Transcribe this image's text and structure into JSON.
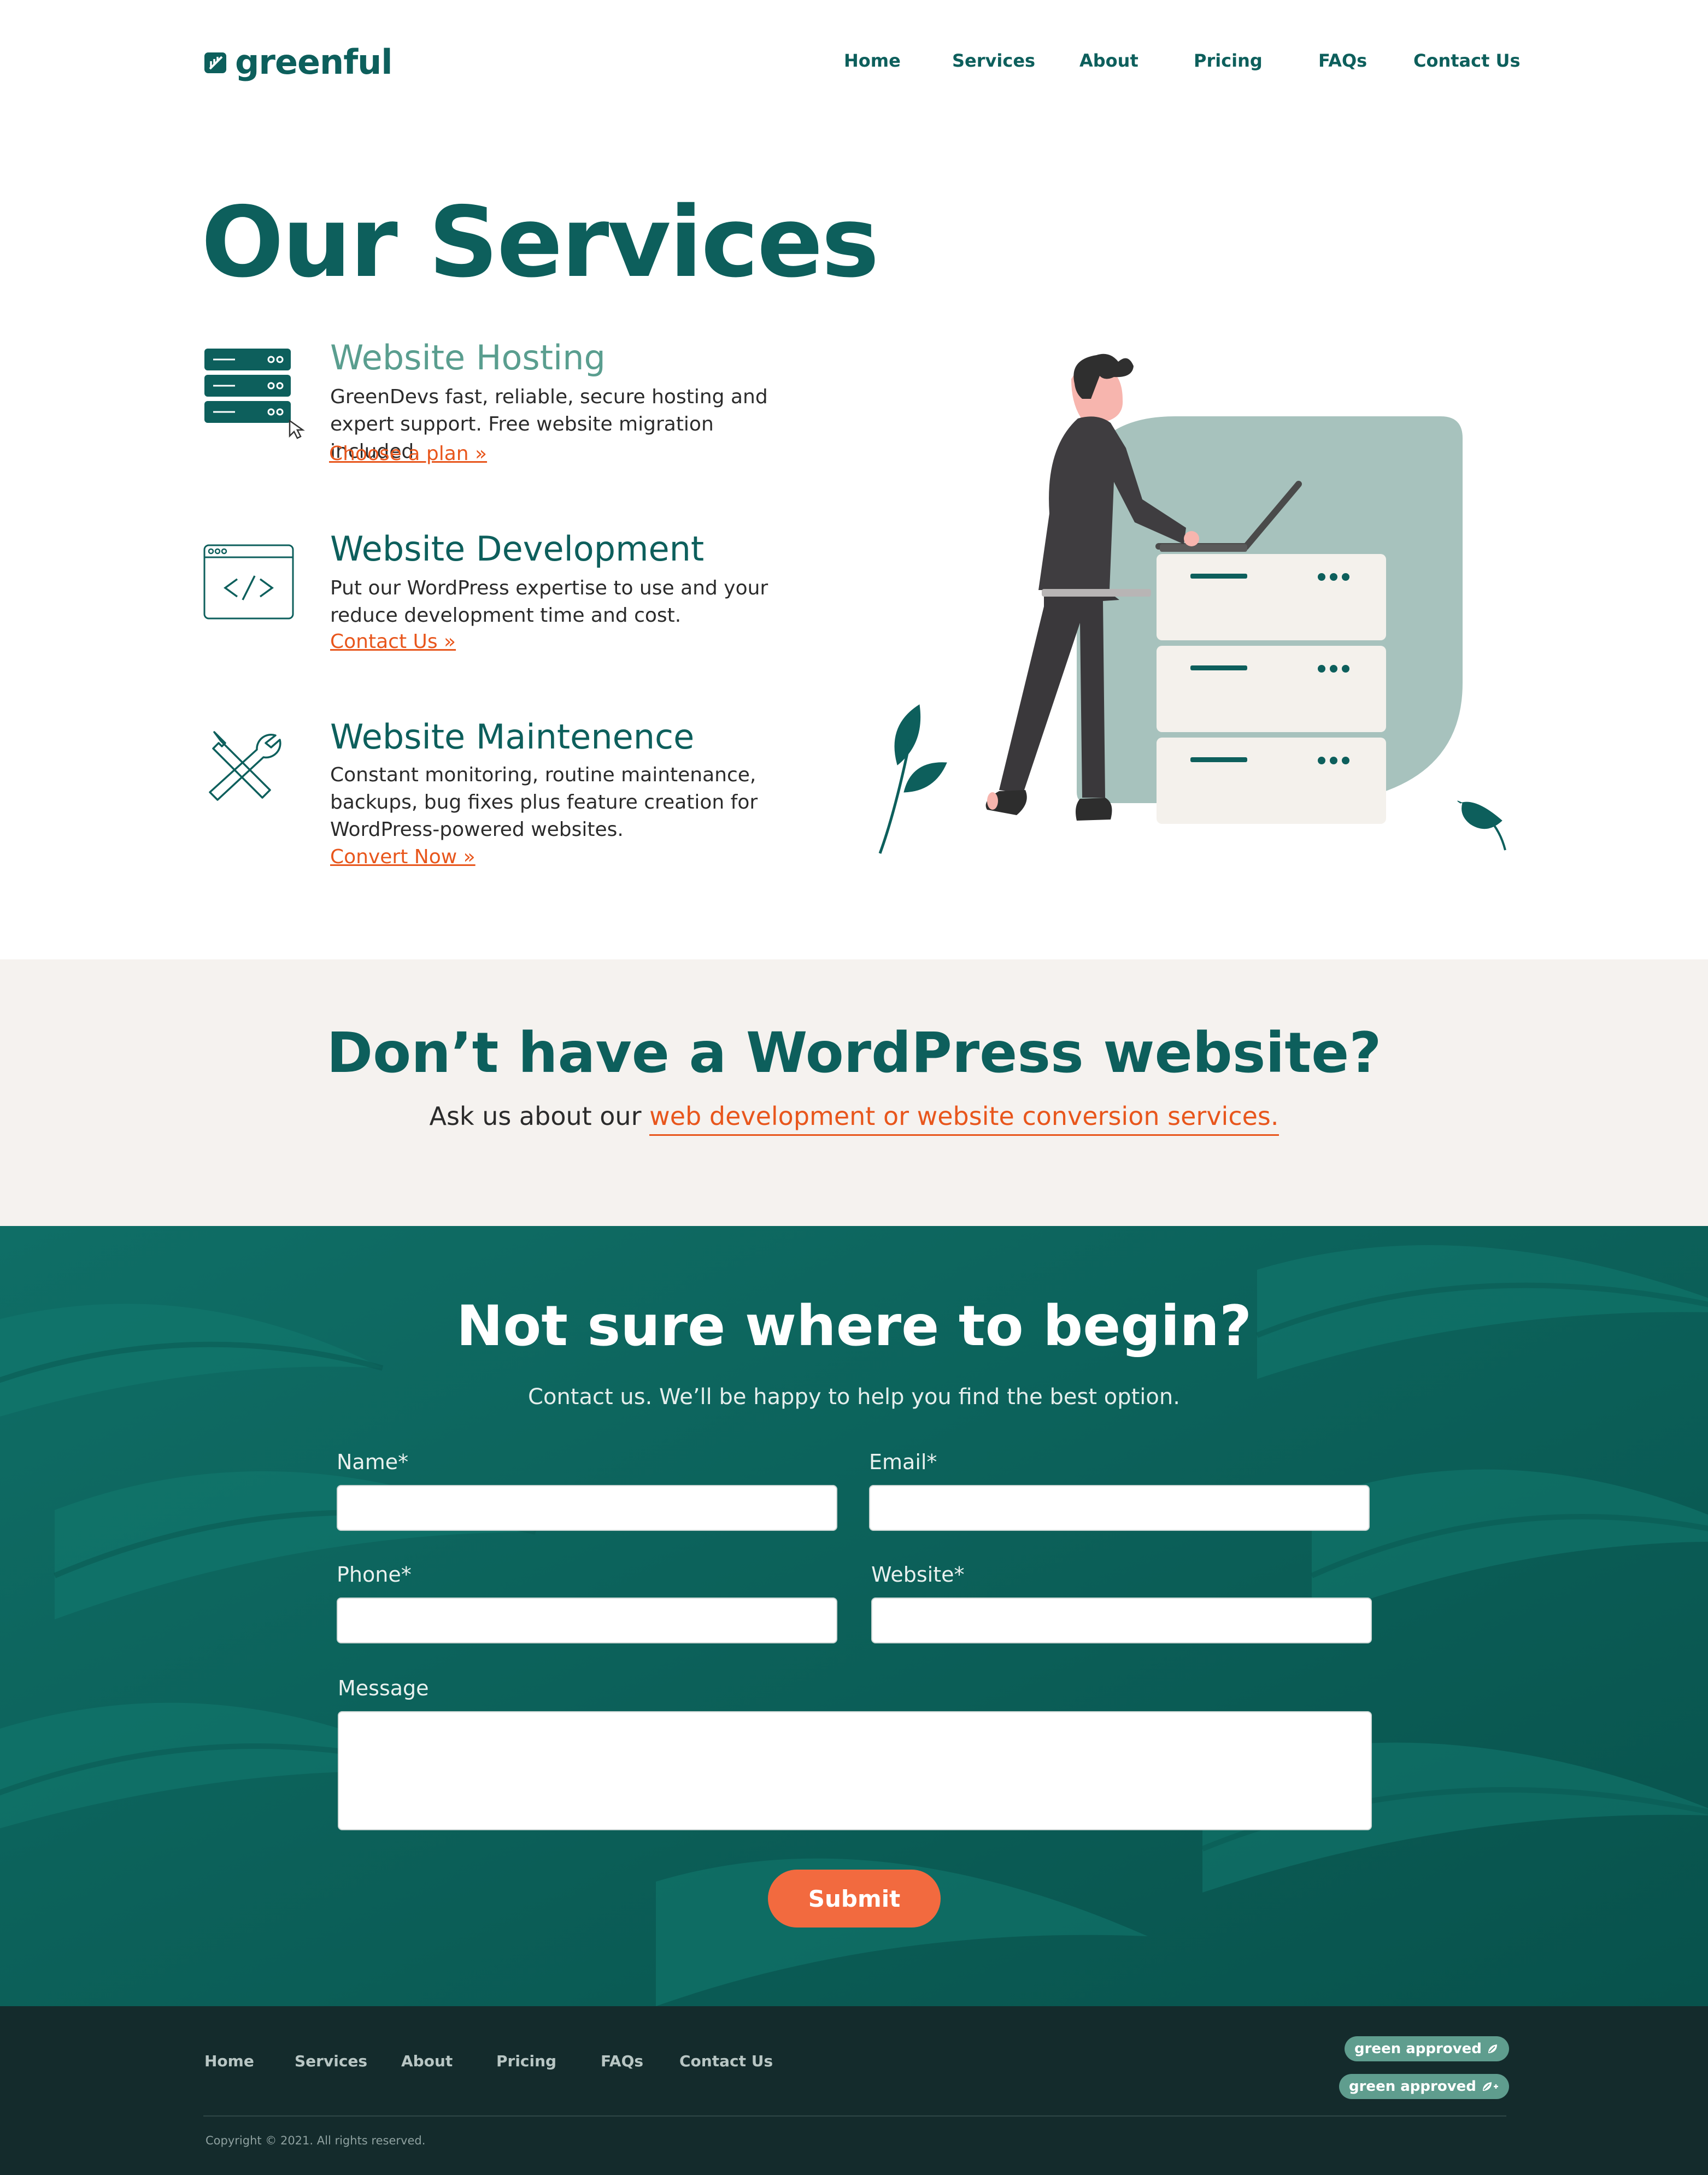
{
  "brand": {
    "name": "greenful",
    "logo_icon": "leaf-box-icon",
    "color": "#0d5f5c"
  },
  "nav": {
    "items": [
      {
        "label": "Home"
      },
      {
        "label": "Services"
      },
      {
        "label": "About"
      },
      {
        "label": "Pricing"
      },
      {
        "label": "FAQs"
      },
      {
        "label": "Contact Us"
      }
    ]
  },
  "services": {
    "title": "Our Services",
    "items": [
      {
        "icon": "server-rack-icon",
        "title": "Website Hosting",
        "description": "GreenDevs fast, reliable, secure hosting and expert support. Free website migration included.",
        "link": "Choose a plan »"
      },
      {
        "icon": "code-window-icon",
        "title": "Website Development",
        "description": "Put our WordPress expertise to use and your reduce development time and cost.",
        "link": "Contact Us »"
      },
      {
        "icon": "wrench-screwdriver-icon",
        "title": "Website Maintenence",
        "description": "Constant monitoring, routine maintenance, backups, bug fixes plus feature creation for WordPress-powered websites.",
        "link": "Convert Now »"
      }
    ],
    "illustration": "person-at-server-illustration"
  },
  "cta_band": {
    "title": "Don’t have a WordPress website?",
    "text": "Ask us about our ",
    "link": "web development or website conversion services."
  },
  "contact": {
    "title": "Not sure where to begin?",
    "subtitle": "Contact us. We’ll be happy to help you find the best option.",
    "fields": {
      "name": {
        "label": "Name*",
        "value": ""
      },
      "email": {
        "label": "Email*",
        "value": ""
      },
      "phone": {
        "label": "Phone*",
        "value": ""
      },
      "website": {
        "label": "Website*",
        "value": ""
      },
      "message": {
        "label": "Message",
        "value": ""
      }
    },
    "submit_label": "Submit",
    "background": "tropical-leaves-pattern"
  },
  "footer": {
    "nav": [
      {
        "label": "Home"
      },
      {
        "label": "Services"
      },
      {
        "label": "About"
      },
      {
        "label": "Pricing"
      },
      {
        "label": "FAQs"
      },
      {
        "label": "Contact Us"
      }
    ],
    "badges": [
      {
        "label": "green approved",
        "icon": "leaf-icon"
      },
      {
        "label": "green approved",
        "icon": "leaf-plus-icon"
      }
    ],
    "copyright": "Copyright © 2021. All rights reserved."
  },
  "colors": {
    "primary": "#0d5f5c",
    "accent": "#e8561c",
    "button": "#f26a3f",
    "band_background": "#f5f2ef",
    "contact_background": "#0b5f58",
    "footer_background": "#142b2c",
    "badge": "#5f9d8e"
  }
}
